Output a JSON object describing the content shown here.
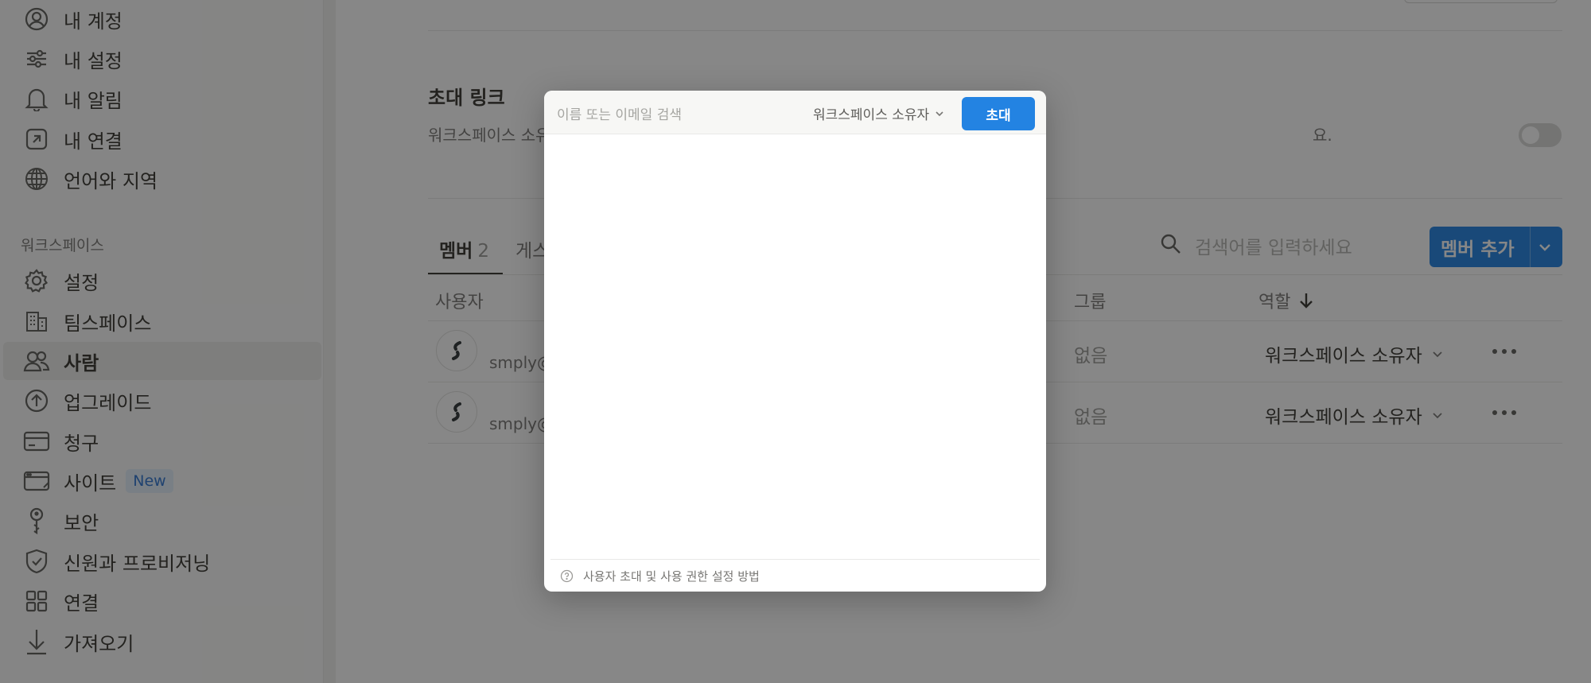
{
  "sidebar": {
    "account_items": [
      {
        "label": "내 계정",
        "icon": "user-circle-icon"
      },
      {
        "label": "내 설정",
        "icon": "sliders-icon"
      },
      {
        "label": "내 알림",
        "icon": "bell-icon"
      },
      {
        "label": "내 연결",
        "icon": "external-link-icon"
      },
      {
        "label": "언어와 지역",
        "icon": "globe-icon"
      }
    ],
    "workspace_heading": "워크스페이스",
    "workspace_items": [
      {
        "label": "설정",
        "icon": "gear-icon"
      },
      {
        "label": "팀스페이스",
        "icon": "building-icon"
      },
      {
        "label": "사람",
        "icon": "people-icon",
        "active": true
      },
      {
        "label": "업그레이드",
        "icon": "arrow-up-circle-icon"
      },
      {
        "label": "청구",
        "icon": "credit-card-icon"
      },
      {
        "label": "사이트",
        "icon": "browser-window-icon",
        "badge": "New"
      },
      {
        "label": "보안",
        "icon": "key-icon"
      },
      {
        "label": "신원과 프로비저닝",
        "icon": "shield-check-icon"
      },
      {
        "label": "연결",
        "icon": "grid-icon"
      },
      {
        "label": "가져오기",
        "icon": "download-icon"
      }
    ]
  },
  "main": {
    "invite_link": {
      "title": "초대 링크",
      "description_visible": "워크스페이스 소유",
      "description_tail": "요.",
      "toggle_on": false
    },
    "tabs": [
      {
        "label": "멤버",
        "count": "2",
        "active": true
      },
      {
        "label": "게스",
        "active": false
      }
    ],
    "search": {
      "placeholder": "검색어를 입력하세요"
    },
    "add_member_button": "멤버 추가",
    "columns": {
      "user": "사용자",
      "group": "그룹",
      "role": "역할"
    },
    "rows": [
      {
        "email": "smply@",
        "group": "없음",
        "role": "워크스페이스 소유자"
      },
      {
        "email": "smply@",
        "group": "없음",
        "role": "워크스페이스 소유자"
      }
    ]
  },
  "modal": {
    "search_placeholder": "이름 또는 이메일 검색",
    "role_selector": "워크스페이스 소유자",
    "invite_button": "초대",
    "footer_help": "사용자 초대 및 사용 권한 설정 방법"
  },
  "colors": {
    "accent": "#2383e2",
    "overlay": "rgba(15,15,15,0.5)",
    "badge_bg": "#e3eefa",
    "badge_text": "#2e75d0"
  }
}
